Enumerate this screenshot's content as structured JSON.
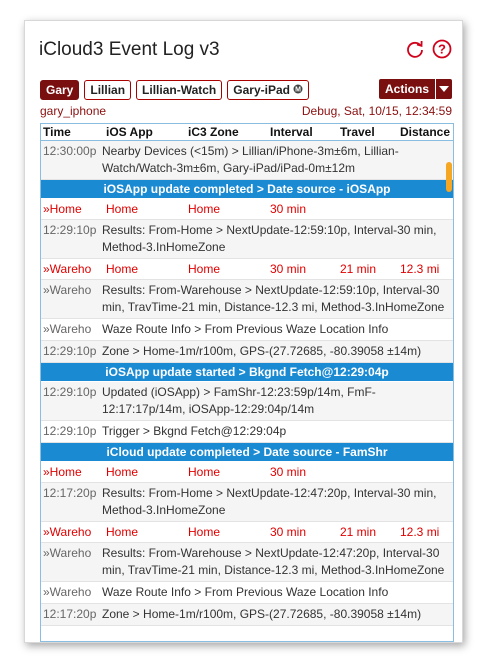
{
  "app": {
    "title": "iCloud3 Event Log v3"
  },
  "icons": {
    "refresh": "refresh-icon",
    "help": "help-icon",
    "accent": "#d0021b"
  },
  "devices": [
    {
      "label": "Gary",
      "active": true
    },
    {
      "label": "Lillian",
      "active": false
    },
    {
      "label": "Lillian-Watch",
      "active": false
    },
    {
      "label": "Gary-iPad",
      "active": false
    }
  ],
  "actions": {
    "label": "Actions"
  },
  "meta": {
    "device": "gary_iphone",
    "status": "Debug, Sat, 10/15, 12:34:59"
  },
  "columns": [
    "Time",
    "iOS App",
    "iC3 Zone",
    "Interval",
    "Travel",
    "Distance"
  ],
  "rows": [
    {
      "type": "text",
      "time": "12:30:00p",
      "text": "Nearby Devices (<15m) > Lillian/iPhone-3m±6m, Lillian-Watch/Watch-3m±6m, Gary-iPad/iPad-0m±12m",
      "alt": true
    },
    {
      "type": "banner",
      "text": "iOSApp update completed > Date source - iOSApp"
    },
    {
      "type": "table",
      "c1": "»Home",
      "c2": "Home",
      "c3": "Home",
      "c4": "30 min",
      "c5": "",
      "c6": ""
    },
    {
      "type": "text",
      "time": "12:29:10p",
      "text": "Results: From-Home > NextUpdate-12:59:10p, Interval-30 min, Method-3.InHomeZone",
      "alt": true
    },
    {
      "type": "table",
      "c1": "»Wareho",
      "c2": "Home",
      "c3": "Home",
      "c4": "30 min",
      "c5": "21 min",
      "c6": "12.3 mi"
    },
    {
      "type": "text",
      "time": "»Wareho",
      "text": "Results: From-Warehouse > NextUpdate-12:59:10p, Interval-30 min, TravTime-21 min, Distance-12.3 mi, Method-3.InHomeZone",
      "alt": true
    },
    {
      "type": "text",
      "time": "»Wareho",
      "text": "Waze Route Info > From Previous Waze Location Info",
      "alt": false
    },
    {
      "type": "text",
      "time": "12:29:10p",
      "text": "Zone > Home-1m/r100m, GPS-(27.72685, -80.39058 ±14m)",
      "alt": true
    },
    {
      "type": "banner",
      "text": "iOSApp update started > Bkgnd Fetch@12:29:04p"
    },
    {
      "type": "text",
      "time": "12:29:10p",
      "text": "Updated (iOSApp) > FamShr-12:23:59p/14m, FmF-12:17:17p/14m, iOSApp-12:29:04p/14m",
      "alt": true
    },
    {
      "type": "text",
      "time": "12:29:10p",
      "text": "Trigger > Bkgnd Fetch@12:29:04p",
      "alt": false
    },
    {
      "type": "banner",
      "text": "iCloud update completed > Date source - FamShr"
    },
    {
      "type": "table",
      "c1": "»Home",
      "c2": "Home",
      "c3": "Home",
      "c4": "30 min",
      "c5": "",
      "c6": ""
    },
    {
      "type": "text",
      "time": "12:17:20p",
      "text": "Results: From-Home > NextUpdate-12:47:20p, Interval-30 min, Method-3.InHomeZone",
      "alt": true
    },
    {
      "type": "table",
      "c1": "»Wareho",
      "c2": "Home",
      "c3": "Home",
      "c4": "30 min",
      "c5": "21 min",
      "c6": "12.3 mi"
    },
    {
      "type": "text",
      "time": "»Wareho",
      "text": "Results: From-Warehouse > NextUpdate-12:47:20p, Interval-30 min, TravTime-21 min, Distance-12.3 mi, Method-3.InHomeZone",
      "alt": true
    },
    {
      "type": "text",
      "time": "»Wareho",
      "text": "Waze Route Info > From Previous Waze Location Info",
      "alt": false
    },
    {
      "type": "text",
      "time": "12:17:20p",
      "text": "Zone > Home-1m/r100m, GPS-(27.72685, -80.39058 ±14m)",
      "alt": true
    }
  ]
}
